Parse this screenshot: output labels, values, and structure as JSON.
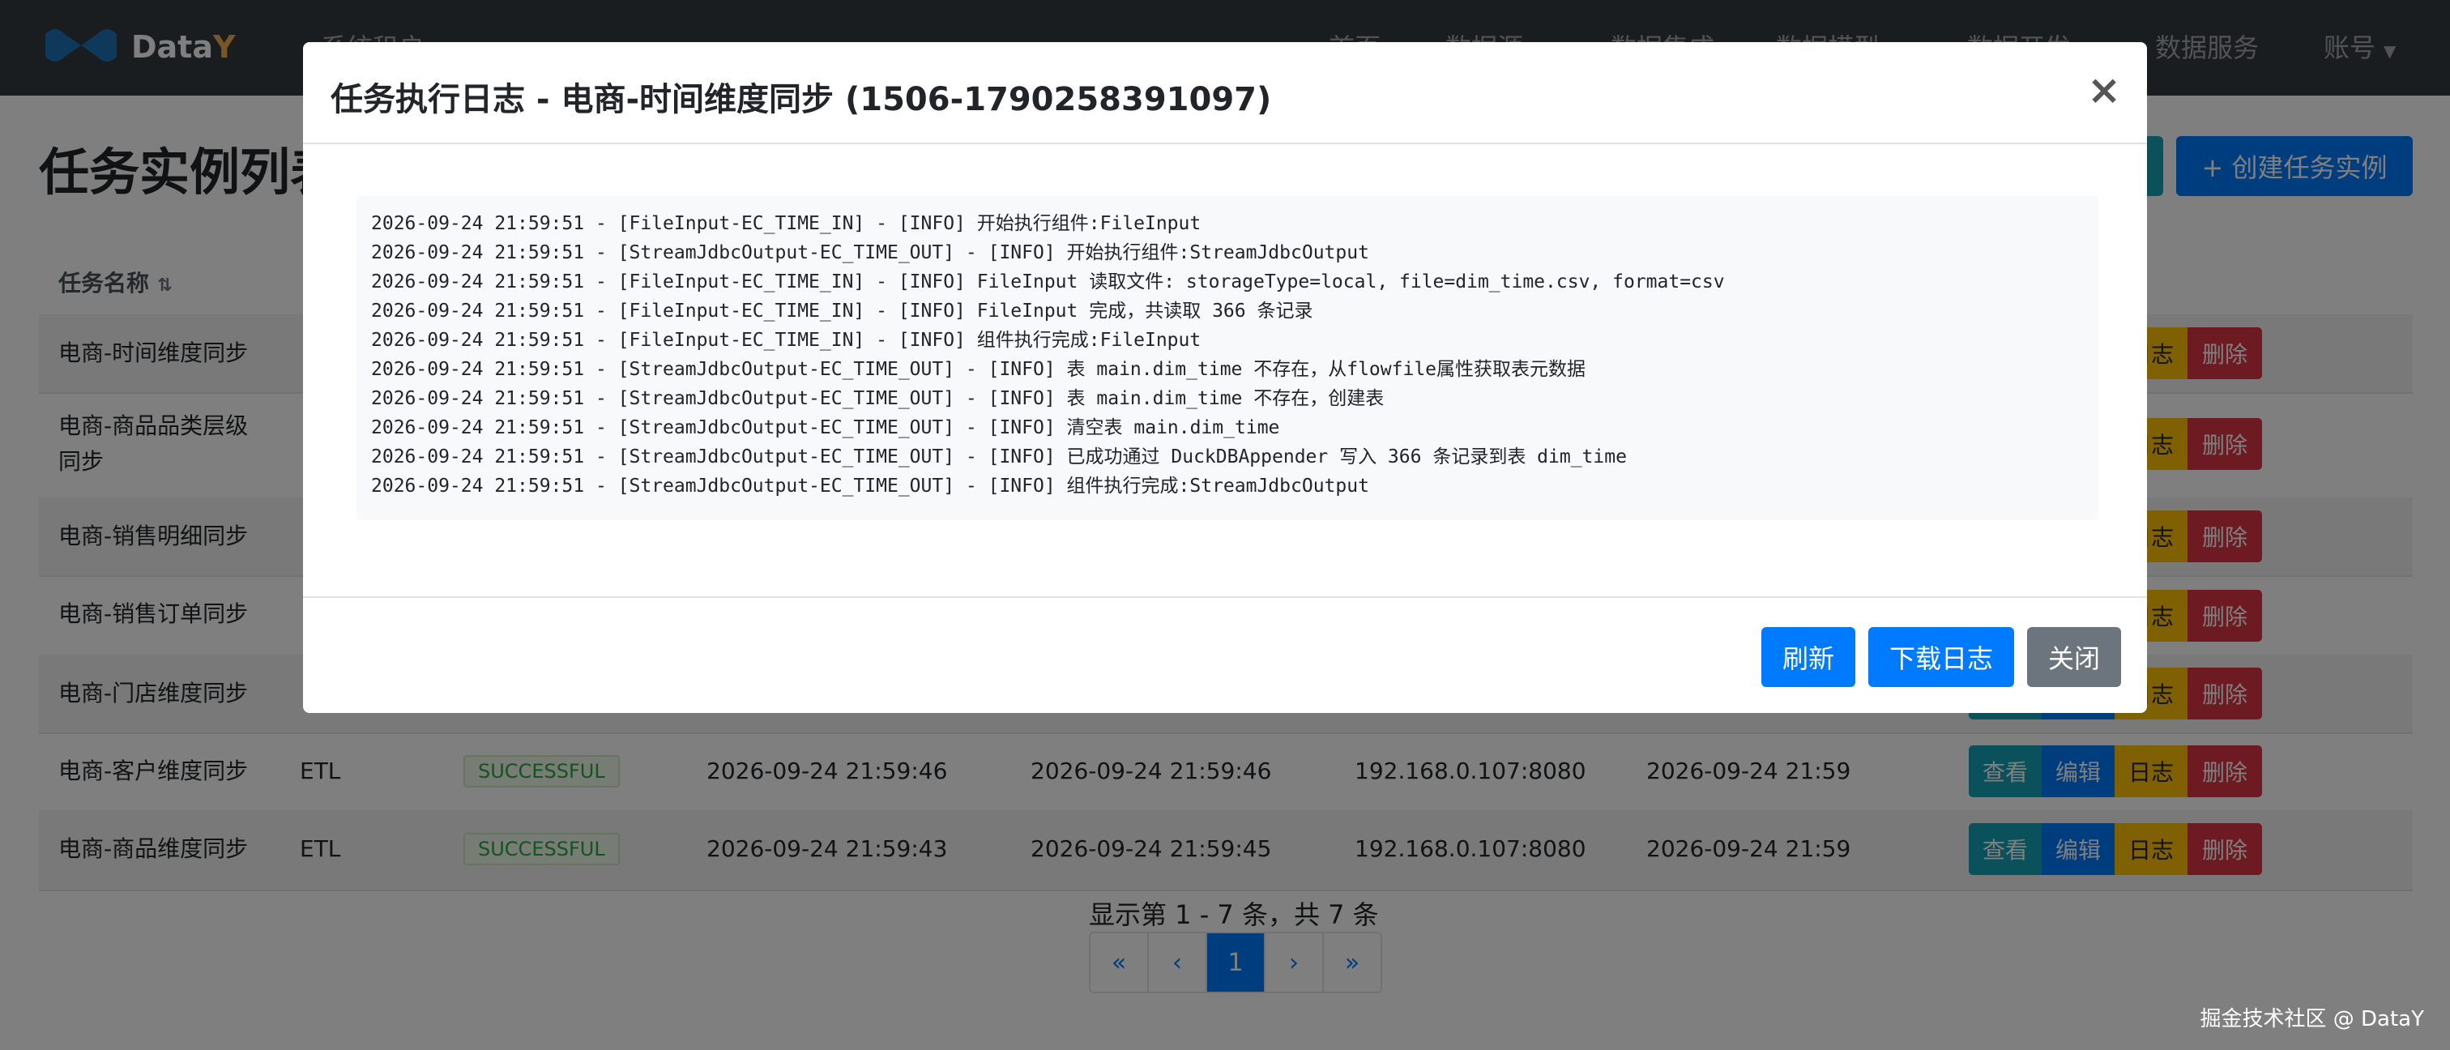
{
  "navbar": {
    "brand_prefix": "Data",
    "brand_suffix": "Y",
    "items": [
      "系统租户",
      "首页",
      "数据源",
      "数据集成",
      "数据模型",
      "数据开发",
      "数据服务",
      "账号"
    ],
    "brand_color": "#f0ad4e"
  },
  "page": {
    "title": "任务实例列表",
    "create_button": "+ 创建任务实例"
  },
  "table": {
    "header_name": "任务名称",
    "rows": [
      {
        "name": "电商-时间维度同步",
        "type": "",
        "status": "",
        "start": "",
        "end": "",
        "host": "",
        "created": ""
      },
      {
        "name": "电商-商品品类层级同步",
        "type": "",
        "status": "",
        "start": "",
        "end": "",
        "host": "",
        "created": ""
      },
      {
        "name": "电商-销售明细同步",
        "type": "",
        "status": "",
        "start": "",
        "end": "",
        "host": "",
        "created": ""
      },
      {
        "name": "电商-销售订单同步",
        "type": "",
        "status": "",
        "start": "",
        "end": "",
        "host": "",
        "created": ""
      },
      {
        "name": "电商-门店维度同步",
        "type": "",
        "status": "",
        "start": "",
        "end": "",
        "host": "",
        "created": ""
      },
      {
        "name": "电商-客户维度同步",
        "type": "ETL",
        "status": "SUCCESSFUL",
        "start": "2026-09-24 21:59:46",
        "end": "2026-09-24 21:59:46",
        "host": "192.168.0.107:8080",
        "created": "2026-09-24 21:59"
      },
      {
        "name": "电商-商品维度同步",
        "type": "ETL",
        "status": "SUCCESSFUL",
        "start": "2026-09-24 21:59:43",
        "end": "2026-09-24 21:59:45",
        "host": "192.168.0.107:8080",
        "created": "2026-09-24 21:59"
      }
    ],
    "actions": {
      "view": "查看",
      "edit": "编辑",
      "log": "日志",
      "delete": "删除"
    }
  },
  "pagination": {
    "info": "显示第 1 - 7 条，共 7 条",
    "first": "«",
    "prev": "‹",
    "current": "1",
    "next": "›",
    "last": "»"
  },
  "watermark": "掘金技术社区 @ DataY",
  "modal": {
    "title": "任务执行日志 - 电商-时间维度同步 (1506-1790258391097)",
    "close_glyph": "×",
    "log_lines": [
      "2026-09-24 21:59:51 - [FileInput-EC_TIME_IN] - [INFO] 开始执行组件:FileInput",
      "2026-09-24 21:59:51 - [StreamJdbcOutput-EC_TIME_OUT] - [INFO] 开始执行组件:StreamJdbcOutput",
      "2026-09-24 21:59:51 - [FileInput-EC_TIME_IN] - [INFO] FileInput 读取文件: storageType=local, file=dim_time.csv, format=csv",
      "2026-09-24 21:59:51 - [FileInput-EC_TIME_IN] - [INFO] FileInput 完成，共读取 366 条记录",
      "2026-09-24 21:59:51 - [FileInput-EC_TIME_IN] - [INFO] 组件执行完成:FileInput",
      "2026-09-24 21:59:51 - [StreamJdbcOutput-EC_TIME_OUT] - [INFO] 表 main.dim_time 不存在，从flowfile属性获取表元数据",
      "2026-09-24 21:59:51 - [StreamJdbcOutput-EC_TIME_OUT] - [INFO] 表 main.dim_time 不存在，创建表",
      "2026-09-24 21:59:51 - [StreamJdbcOutput-EC_TIME_OUT] - [INFO] 清空表 main.dim_time",
      "2026-09-24 21:59:51 - [StreamJdbcOutput-EC_TIME_OUT] - [INFO] 已成功通过 DuckDBAppender 写入 366 条记录到表 dim_time",
      "2026-09-24 21:59:51 - [StreamJdbcOutput-EC_TIME_OUT] - [INFO] 组件执行完成:StreamJdbcOutput"
    ],
    "buttons": {
      "refresh": "刷新",
      "download": "下载日志",
      "close": "关闭"
    }
  }
}
